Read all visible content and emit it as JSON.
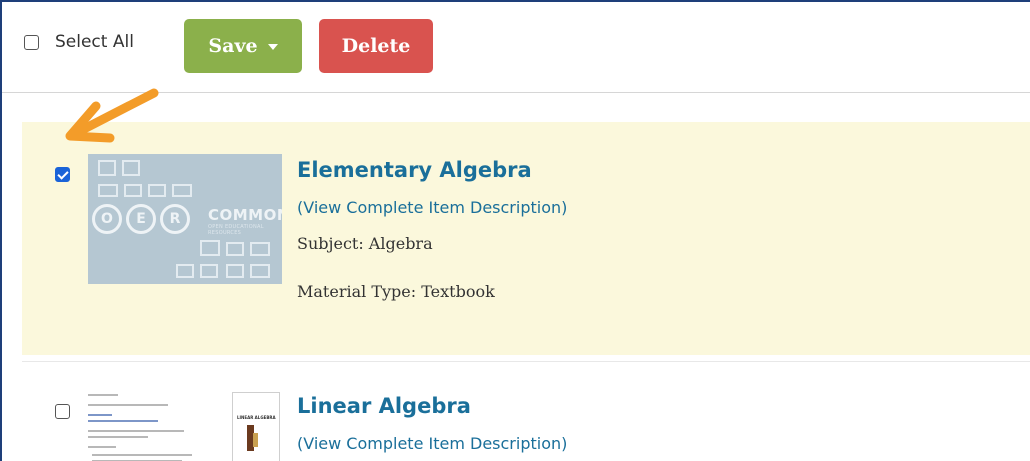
{
  "toolbar": {
    "select_all_label": "Select All",
    "select_all_checked": false,
    "save_label": "Save",
    "delete_label": "Delete"
  },
  "colors": {
    "save": "#8bb04b",
    "delete": "#d9534f",
    "link": "#1a6f9a",
    "selected_bg": "#fbf8dc",
    "annotation_arrow": "#f39c29"
  },
  "items": [
    {
      "checked": true,
      "title": "Elementary Algebra",
      "link_label": "(View Complete Item Description)",
      "subject": "Subject: Algebra",
      "material_type": "Material Type: Textbook",
      "thumbnail": {
        "text": "COMMONS",
        "subtext": "OPEN EDUCATIONAL RESOURCES",
        "letters": [
          "O",
          "E",
          "R"
        ]
      }
    },
    {
      "checked": false,
      "title": "Linear Algebra",
      "link_label": "(View Complete Item Description)",
      "thumbnail": {
        "book_title": "LINEAR ALGEBRA"
      }
    }
  ],
  "icons": {
    "annotation": "arrow-pointer-icon",
    "save_dropdown": "caret-down-icon"
  }
}
